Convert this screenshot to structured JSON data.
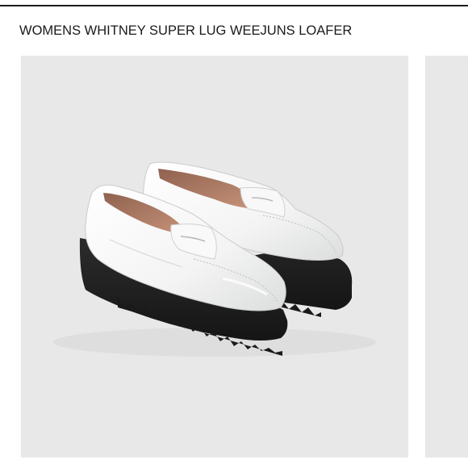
{
  "product": {
    "title": "WOMENS WHITNEY SUPER LUG WEEJUNS LOAFER"
  },
  "gallery": {
    "background_color": "#e8e8e8",
    "main_image": {
      "icon": "white-penny-loafer-pair-image",
      "upper_color": "#f4f5f4",
      "lining_color": "#a87760",
      "sole_color": "#1f1f20"
    },
    "next_image": {
      "icon": "next-product-image-peek"
    }
  }
}
